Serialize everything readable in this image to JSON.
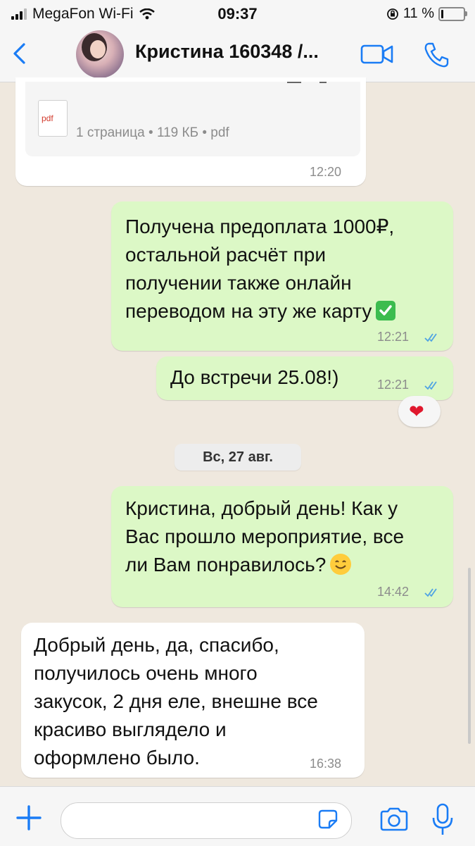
{
  "status_bar": {
    "carrier": "MegaFon Wi-Fi",
    "time": "09:37",
    "battery": "11 %",
    "battery_level": 0.11
  },
  "header": {
    "contact": "Кристина 160348 /..."
  },
  "doc_message": {
    "file_meta": "1 страница • 119 КБ • pdf",
    "file_type": "pdf",
    "time": "12:20"
  },
  "messages": [
    {
      "direction": "out",
      "lines": [
        "Получена предоплата 1000₽,",
        "остальной расчёт при",
        "получении также онлайн",
        "переводом на эту же карту"
      ],
      "time": "12:21",
      "status": "read",
      "trailing_emoji": "check-mark-button"
    },
    {
      "direction": "out",
      "lines": [
        "До встречи 25.08!)"
      ],
      "time": "12:21",
      "status": "read",
      "reaction": "❤"
    },
    {
      "direction": "out",
      "lines": [
        "Кристина, добрый день! Как у",
        "Вас прошло мероприятие, все",
        "ли Вам понравилось?"
      ],
      "time": "14:42",
      "status": "read",
      "trailing_emoji": "smiling-face"
    },
    {
      "direction": "in",
      "lines": [
        "Добрый день, да, спасибо,",
        "получилось очень много",
        "закусок, 2 дня еле, внешне все",
        "красиво выглядело и",
        "оформлено было."
      ],
      "time": "16:38"
    }
  ],
  "date_separator": "Вс, 27 авг.",
  "colors": {
    "accent": "#1a7cf5",
    "incoming": "#ffffff",
    "outgoing": "#dcf8c6",
    "background": "#efe8de",
    "read_ticks": "#4fa3e3"
  }
}
